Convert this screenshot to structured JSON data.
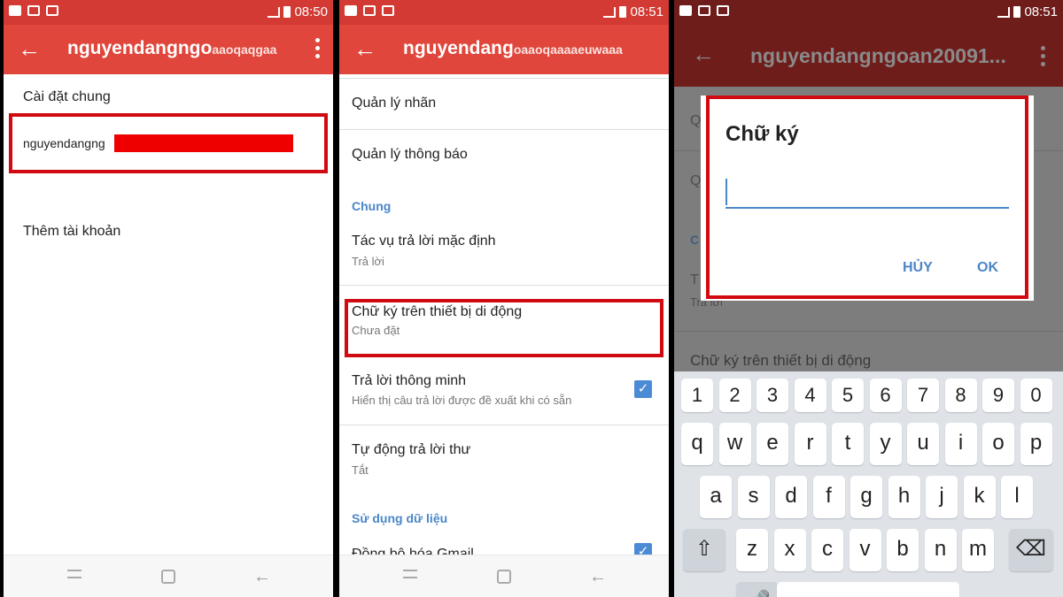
{
  "status": {
    "time1": "08:50",
    "time2": "08:51",
    "time3": "08:51"
  },
  "panel1": {
    "title": "nguyendangngo",
    "blurred_tail": "aaoqaqgaa",
    "section": "Cài đặt chung",
    "account": "nguyendangng",
    "add_account": "Thêm tài khoản"
  },
  "panel2": {
    "title": "nguyendang",
    "blurred_tail": "oaaoqaaaaeuwaaa",
    "items": [
      {
        "label": "Quản lý nhãn"
      },
      {
        "label": "Quản lý thông báo"
      }
    ],
    "section_general": "Chung",
    "default_reply": {
      "label": "Tác vụ trả lời mặc định",
      "value": "Trả lời"
    },
    "mobile_signature": {
      "label": "Chữ ký trên thiết bị di động",
      "value": "Chưa đặt"
    },
    "smart_reply": {
      "label": "Trả lời thông minh",
      "value": "Hiển thị câu trả lời được đề xuất khi có sẵn",
      "checked": true
    },
    "auto_reply": {
      "label": "Tự động trả lời thư",
      "value": "Tắt"
    },
    "section_data": "Sử dụng dữ liệu",
    "sync_partial": "Đồng bộ hóa Gmail"
  },
  "panel3": {
    "title": "nguyendangngoan20091...",
    "bg_fragments": [
      "Q",
      "Q",
      "C",
      "T"
    ],
    "bg_reply": "Trả lời",
    "bg_signature": "Chữ ký trên thiết bị di động",
    "dialog": {
      "title": "Chữ ký",
      "input_value": "",
      "cancel": "HỦY",
      "ok": "OK"
    },
    "keyboard": {
      "numbers": [
        "1",
        "2",
        "3",
        "4",
        "5",
        "6",
        "7",
        "8",
        "9",
        "0"
      ],
      "row1": [
        "q",
        "w",
        "e",
        "r",
        "t",
        "y",
        "u",
        "i",
        "o",
        "p"
      ],
      "row2": [
        "a",
        "s",
        "d",
        "f",
        "g",
        "h",
        "j",
        "k",
        "l"
      ],
      "row3": [
        "z",
        "x",
        "c",
        "v",
        "b",
        "n",
        "m"
      ]
    }
  },
  "colors": {
    "accent": "#e0463b",
    "highlight": "#d10a11",
    "link": "#4b86c6"
  }
}
